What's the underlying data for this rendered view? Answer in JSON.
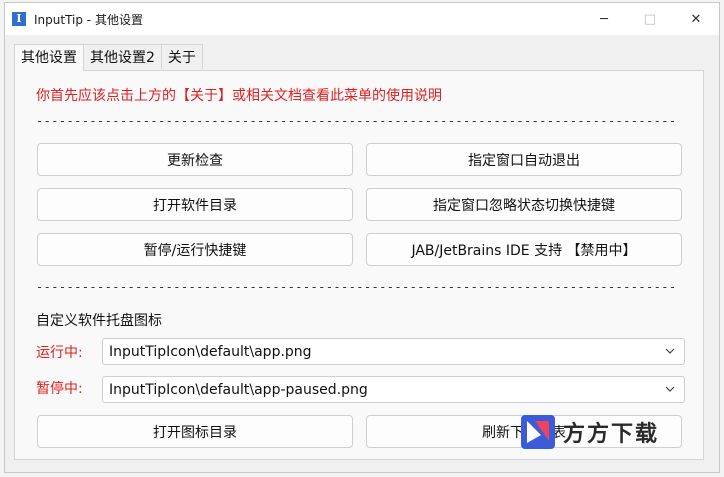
{
  "window": {
    "title": "InputTip - 其他设置",
    "app_icon_glyph": "I",
    "minimize_glyph": "─",
    "maximize_glyph": "□",
    "close_glyph": "✕"
  },
  "tabs": [
    {
      "label": "其他设置",
      "active": true
    },
    {
      "label": "其他设置2",
      "active": false
    },
    {
      "label": "关于",
      "active": false
    }
  ],
  "notice": "你首先应该点击上方的【关于】或相关文档查看此菜单的使用说明",
  "separator": "----------------------------------------------------------------------------------------",
  "buttons": {
    "check_update": "更新检查",
    "auto_exit": "指定窗口自动退出",
    "open_dir": "打开软件目录",
    "ignore_state": "指定窗口忽略状态切换快捷键",
    "pause_hotkey": "暂停/运行快捷键",
    "jab_support": "JAB/JetBrains IDE 支持 【禁用中】",
    "open_icon_dir": "打开图标目录",
    "refresh_list": "刷新下拉列表"
  },
  "tray_section": {
    "title": "自定义软件托盘图标",
    "running_label": "运行中:",
    "running_value": "InputTipIcon\\default\\app.png",
    "paused_label": "暂停中:",
    "paused_value": "InputTipIcon\\default\\app-paused.png"
  },
  "watermark": {
    "text": "方方下载"
  },
  "colors": {
    "warning": "#e02020",
    "icon_blue": "#2e6fd1"
  }
}
